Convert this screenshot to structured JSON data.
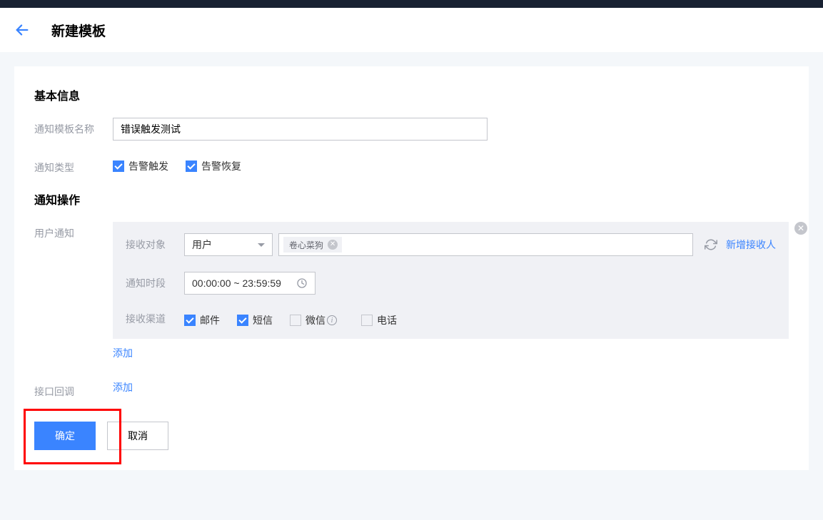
{
  "header": {
    "title": "新建模板"
  },
  "sections": {
    "basic_info": "基本信息",
    "notify_ops": "通知操作"
  },
  "labels": {
    "template_name": "通知模板名称",
    "notify_type": "通知类型",
    "user_notify": "用户通知",
    "api_callback": "接口回调",
    "receive_target": "接收对象",
    "notify_time": "通知时段",
    "receive_channel": "接收渠道"
  },
  "form": {
    "template_name_value": "错误触发测试",
    "notify_types": {
      "alarm_trigger": {
        "label": "告警触发",
        "checked": true
      },
      "alarm_recover": {
        "label": "告警恢复",
        "checked": true
      }
    },
    "receive_select_label": "用户",
    "receive_tags": [
      {
        "label": "卷心菜狗"
      }
    ],
    "time_range": "00:00:00 ~ 23:59:59",
    "channels": {
      "mail": {
        "label": "邮件",
        "checked": true
      },
      "sms": {
        "label": "短信",
        "checked": true
      },
      "wechat": {
        "label": "微信",
        "checked": false
      },
      "phone": {
        "label": "电话",
        "checked": false
      }
    }
  },
  "actions": {
    "add_recipient": "新增接收人",
    "add": "添加",
    "confirm": "确定",
    "cancel": "取消"
  }
}
